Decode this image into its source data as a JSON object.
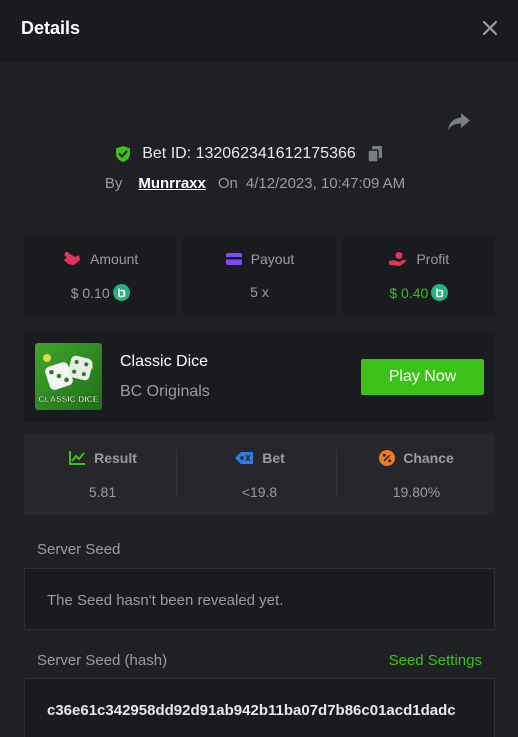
{
  "header": {
    "title": "Details"
  },
  "bet": {
    "id_label": "Bet ID: 132062341612175366",
    "by": "By",
    "user": "Munrraxx",
    "on": "On",
    "date": "4/12/2023, 10:47:09 AM"
  },
  "stats": {
    "amount": {
      "label": "Amount",
      "value": "$ 0.10"
    },
    "payout": {
      "label": "Payout",
      "value": "5 x"
    },
    "profit": {
      "label": "Profit",
      "value": "$ 0.40"
    }
  },
  "game": {
    "name": "Classic Dice",
    "provider": "BC Originals",
    "thumb_text": "CLASSIC DICE",
    "play_label": "Play Now"
  },
  "result": {
    "result": {
      "label": "Result",
      "value": "5.81"
    },
    "bet": {
      "label": "Bet",
      "value": "<19.8"
    },
    "chance": {
      "label": "Chance",
      "value": "19.80%"
    }
  },
  "seeds": {
    "server_seed_label": "Server Seed",
    "server_seed_value": "The Seed hasn't been revealed yet.",
    "hash_label": "Server Seed (hash)",
    "seed_settings_label": "Seed Settings",
    "hash_value": "c36e61c342958dd92d91ab942b11ba07d7b86c01acd1dadc"
  },
  "colors": {
    "accent_green": "#3bc117",
    "background": "#1f2023",
    "panel": "#1a1b1e",
    "coin": "#28b085"
  },
  "icons": [
    "close-icon",
    "share-icon",
    "shield-check-icon",
    "copy-icon",
    "coin-icon",
    "amount-icon",
    "payout-wallet-icon",
    "profit-hand-icon",
    "result-chart-icon",
    "bet-tag-icon",
    "chance-percent-icon"
  ]
}
